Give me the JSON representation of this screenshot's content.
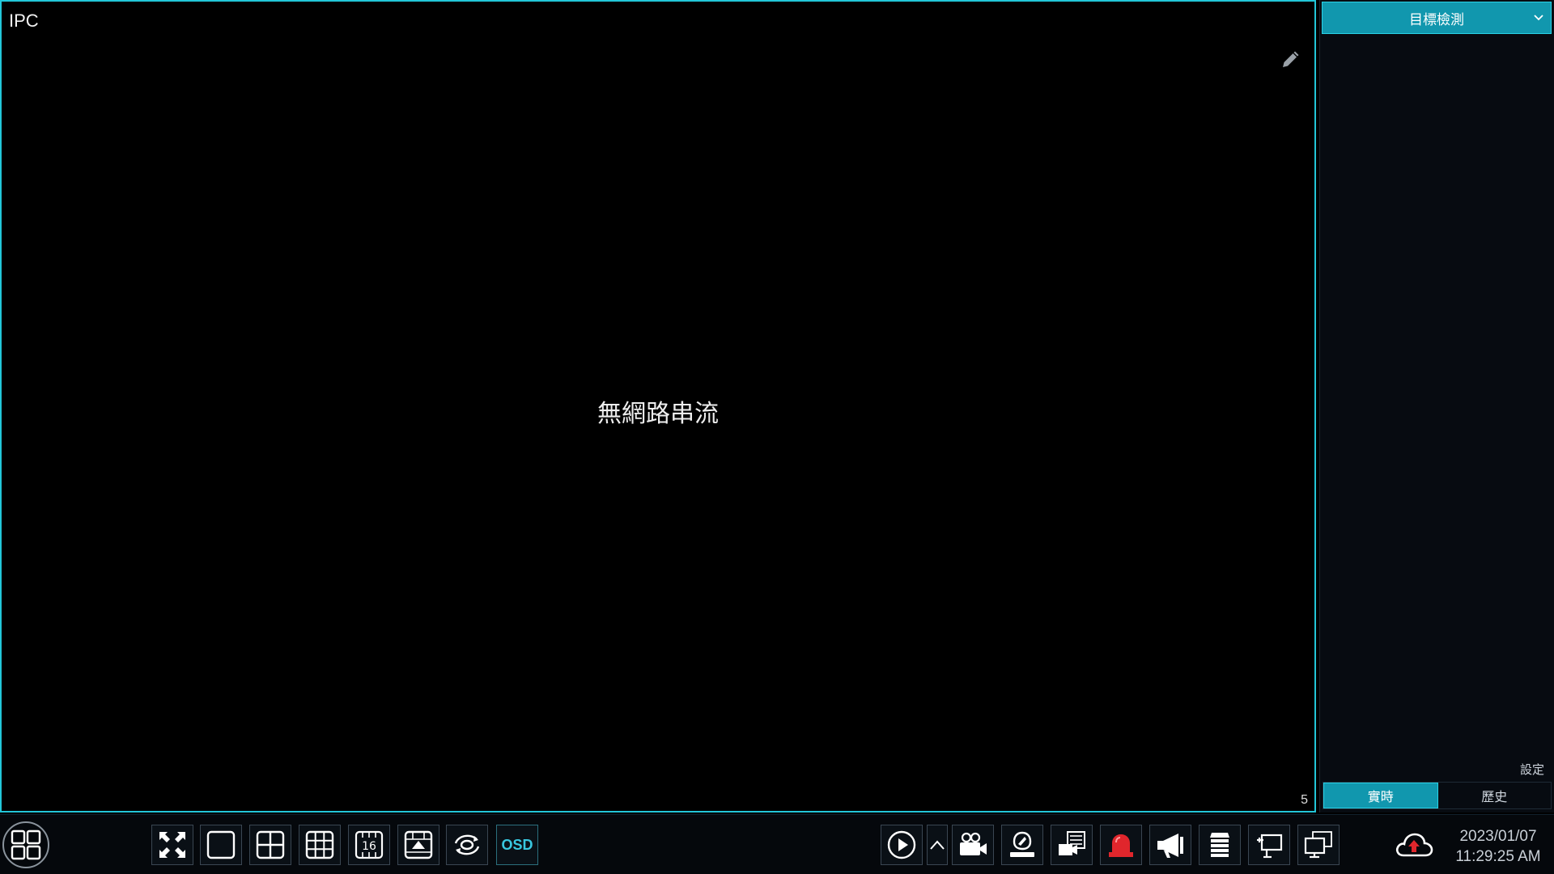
{
  "live_view": {
    "camera_name": "IPC",
    "message": "無網路串流",
    "channel_number": "5"
  },
  "side_panel": {
    "selected_mode": "目標檢測",
    "settings_label": "設定",
    "tabs": [
      {
        "label": "實時",
        "active": true
      },
      {
        "label": "歷史",
        "active": false
      }
    ]
  },
  "toolbar": {
    "osd_label": "OSD",
    "layout_16_label": "16",
    "date": "2023/01/07",
    "time": "11:29:25 AM"
  },
  "icons": {
    "menu": "start-menu-grid-icon",
    "fullscreen": "fullscreen-icon",
    "edit": "pencil-icon",
    "cloud": "cloud-upload-icon",
    "alarm": "alarm-light-icon"
  },
  "colors": {
    "accent": "#1197ae",
    "border": "#22c6d8",
    "alarm": "#e0262c"
  }
}
